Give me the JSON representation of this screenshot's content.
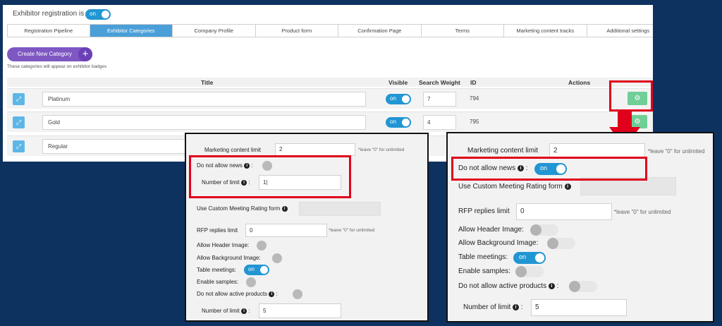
{
  "header": {
    "registration_label": "Exhibitor registration is",
    "toggle_label": "on"
  },
  "tabs": [
    {
      "label": "Registration Pipeline"
    },
    {
      "label": "Exhibitor Categories"
    },
    {
      "label": "Company Profile"
    },
    {
      "label": "Product form"
    },
    {
      "label": "Confirmation Page"
    },
    {
      "label": "Terms"
    },
    {
      "label": "Marketing content tracks"
    },
    {
      "label": "Additional settings"
    }
  ],
  "create_button": {
    "label": "Create New Category",
    "plus": "+"
  },
  "hint": "These categories will appear on exhibitor badges",
  "table": {
    "columns": {
      "title": "Title",
      "visible": "Visible",
      "weight": "Search Weight",
      "id": "ID",
      "actions": "Actions"
    },
    "rows": [
      {
        "title": "Platinum",
        "visible": "on",
        "weight": "7",
        "id": "794"
      },
      {
        "title": "Gold",
        "visible": "on",
        "weight": "4",
        "id": "795"
      },
      {
        "title": "Regular"
      }
    ]
  },
  "panel_left": {
    "marketing_label": "Marketing content limit",
    "marketing_value": "2",
    "marketing_note": "*leave \"0\" for unlimited",
    "no_news_label": "Do not allow news",
    "number_limit_label": "Number of limit",
    "number_limit_value": "1|",
    "rating_label": "Use Custom Meeting Rating form",
    "rfp_label": "RFP replies limit",
    "rfp_value": "0",
    "rfp_note": "*leave \"0\" for unlimited",
    "header_image_label": "Allow Header Image:",
    "bg_image_label": "Allow Background Image:",
    "table_meetings_label": "Table meetings:",
    "table_meetings_toggle": "on",
    "samples_label": "Enable samples:",
    "active_products_label": "Do not allow active products",
    "number_limit2_label": "Number of limit",
    "number_limit2_value": "5"
  },
  "panel_right": {
    "marketing_label": "Marketing content limit",
    "marketing_value": "2",
    "marketing_note": "*leave \"0\" for unlimited",
    "no_news_label": "Do not allow news",
    "no_news_toggle": "on",
    "rating_label": "Use Custom Meeting Rating form",
    "rfp_label": "RFP replies limit",
    "rfp_value": "0",
    "rfp_note": "*leave \"0\" for unlimited",
    "header_image_label": "Allow Header Image:",
    "bg_image_label": "Allow Background Image:",
    "table_meetings_label": "Table meetings:",
    "table_meetings_toggle": "on",
    "samples_label": "Enable samples:",
    "active_products_label": "Do not allow active products",
    "number_limit_label": "Number of limit",
    "number_limit_value": "5"
  },
  "colors": {
    "background": "#0d3260",
    "accent": "#2196d3",
    "highlight": "#e0001b",
    "action_button": "#6fcf97",
    "create_button": "#7e57c2"
  },
  "icons": {
    "drag": "drag-handle-icon",
    "gear": "gear-icon",
    "info": "info-icon",
    "arrow": "arrow-down-icon"
  }
}
